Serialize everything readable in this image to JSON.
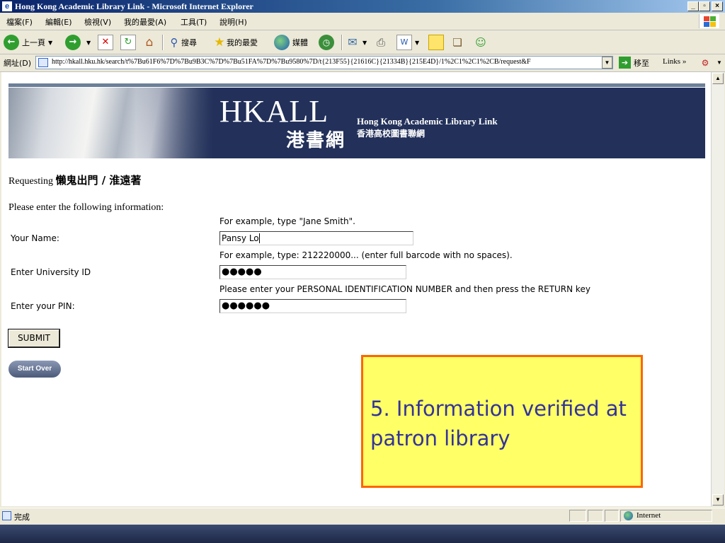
{
  "window": {
    "title": "Hong Kong Academic Library Link - Microsoft Internet Explorer",
    "min_glyph": "_",
    "max_glyph": "▫",
    "close_glyph": "×"
  },
  "menu": {
    "items": [
      "檔案(F)",
      "編輯(E)",
      "檢視(V)",
      "我的最愛(A)",
      "工具(T)",
      "說明(H)"
    ]
  },
  "toolbar": {
    "back_label": "上一頁",
    "search_label": "搜尋",
    "favorites_label": "我的最愛",
    "media_label": "媒體"
  },
  "address": {
    "label": "網址(D)",
    "url": "http://hkall.hku.hk/search/t%7Bu61F6%7D%7Bu9B3C%7D%7Bu51FA%7D%7Bu9580%7D/t{213F55}{21616C}{21334B}{215E4D}/1%2C1%2C1%2CB/request&F",
    "go_label": "移至",
    "links_label": "Links"
  },
  "banner": {
    "title_en": "HKALL",
    "title_cn": "港書網",
    "subtitle_en": "Hong Kong Academic Library Link",
    "subtitle_cn": "香港高校圖書聯網"
  },
  "page": {
    "requesting_prefix": "Requesting ",
    "requesting_title": "懶鬼出門 / 淮遠著",
    "please_enter": "Please enter the following information:",
    "name_hint": "For example, type \"Jane Smith\".",
    "name_label": "Your Name:",
    "name_value": "Pansy Lo",
    "id_hint": "For example, type: 212220000... (enter full barcode with no spaces).",
    "id_label": "Enter University ID",
    "id_value": "●●●●●",
    "pin_hint": "Please enter your PERSONAL IDENTIFICATION NUMBER and then press the RETURN key",
    "pin_label": "Enter your PIN:",
    "pin_value": "●●●●●●",
    "submit_label": "SUBMIT",
    "start_over_label": "Start Over"
  },
  "callout": {
    "text": " 5. Information verified at patron library"
  },
  "status": {
    "text": "完成",
    "zone": "Internet"
  },
  "colors": {
    "callout_bg": "#ffff66",
    "callout_border": "#ff6600",
    "callout_text": "#333399",
    "banner_bg": "#22305a"
  }
}
